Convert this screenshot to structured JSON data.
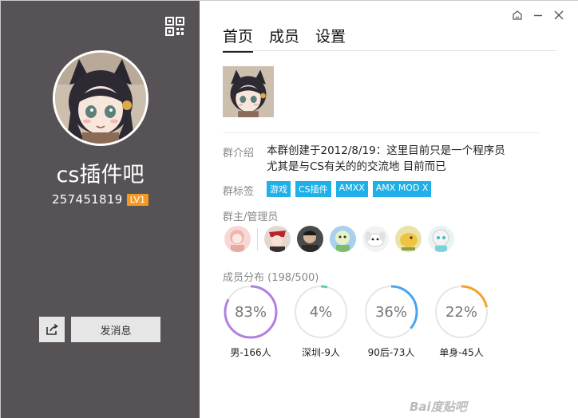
{
  "group": {
    "name": "cs插件吧",
    "id": "257451819",
    "level": "LV1"
  },
  "left": {
    "send_message_label": "发消息",
    "qr_icon": "qr-code-icon",
    "share_icon": "share-icon"
  },
  "tabs": [
    "首页",
    "成员",
    "设置"
  ],
  "window_controls": [
    "skin-icon",
    "minimize-icon",
    "close-icon"
  ],
  "intro": {
    "label": "群介绍",
    "line1": "本群创建于2012/8/19：这里目前只是一个程序员",
    "line2": "尤其是与CS有关的的交流地  目前而已"
  },
  "tags": {
    "label": "群标签",
    "items": [
      "游戏",
      "CS插件",
      "AMXX",
      "AMX MOD X"
    ]
  },
  "admins": {
    "label": "群主/管理员",
    "count": 7
  },
  "members": {
    "label": "成员分布",
    "count": "(198/500)",
    "stats": [
      {
        "value": "83%",
        "fraction": 0.83,
        "label": "男-166人",
        "color": "#b07fe0"
      },
      {
        "value": "4%",
        "fraction": 0.04,
        "label": "深圳-9人",
        "color": "#5fd0a6"
      },
      {
        "value": "36%",
        "fraction": 0.36,
        "label": "90后-73人",
        "color": "#4aa3f0"
      },
      {
        "value": "22%",
        "fraction": 0.22,
        "label": "单身-45人",
        "color": "#f4a12a"
      }
    ]
  },
  "watermark": "Bai度贴吧"
}
